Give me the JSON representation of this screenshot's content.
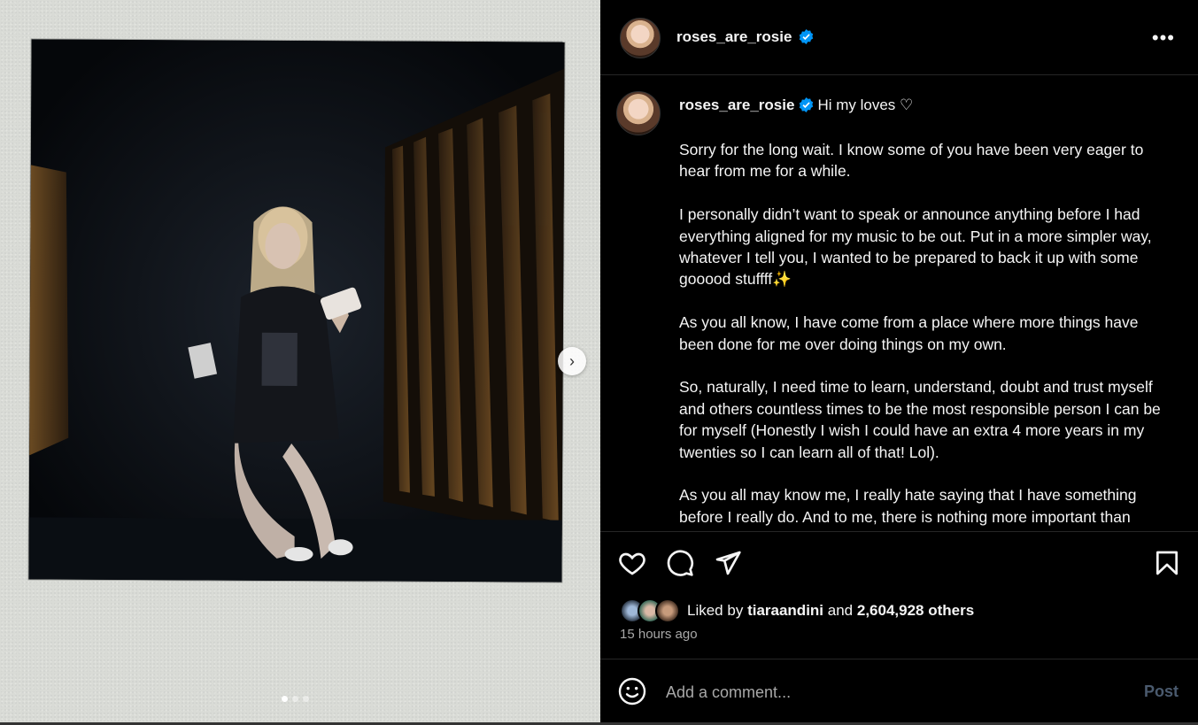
{
  "post": {
    "username": "roses_are_rosie",
    "verified": true
  },
  "media": {
    "slide_count": 3,
    "active_slide": 1
  },
  "caption": {
    "greeting": "Hi my loves ♡",
    "paragraphs": [
      "Sorry for the long wait. I know some of you have been very eager to hear from me for a while.",
      "I personally didn’t want to speak or announce anything before I had everything aligned for my music to be out. Put in a more simpler way, whatever I tell you, I wanted to be prepared to back it up with some gooood stuffff✨",
      "As you all know, I have come from a place where more things have been done for me over doing things on my own.",
      "So, naturally, I need time to learn, understand, doubt and trust myself and others countless times to be the most responsible person I can be for myself (Honestly I wish I could have an extra 4 more years in my twenties so I can learn all of that! Lol).",
      "As you all may know me, I really hate saying that I have something before I really do. And to me, there is nothing more important than delivering to you what I dreamt, believe and think"
    ]
  },
  "engagement": {
    "liked_by_prefix": "Liked by",
    "liked_by_user": "tiaraandini",
    "and": "and",
    "others": "2,604,928 others",
    "timestamp": "15 hours ago"
  },
  "comment": {
    "placeholder": "Add a comment...",
    "post_label": "Post"
  },
  "colors": {
    "background": "#000000",
    "verified_blue": "#0095f6",
    "post_disabled": "#4a5a6e"
  },
  "icons": {
    "more": "more-options-icon",
    "next": "chevron-right-icon",
    "like": "heart-icon",
    "comment": "comment-icon",
    "share": "send-icon",
    "save": "bookmark-icon",
    "emoji": "emoji-icon"
  }
}
